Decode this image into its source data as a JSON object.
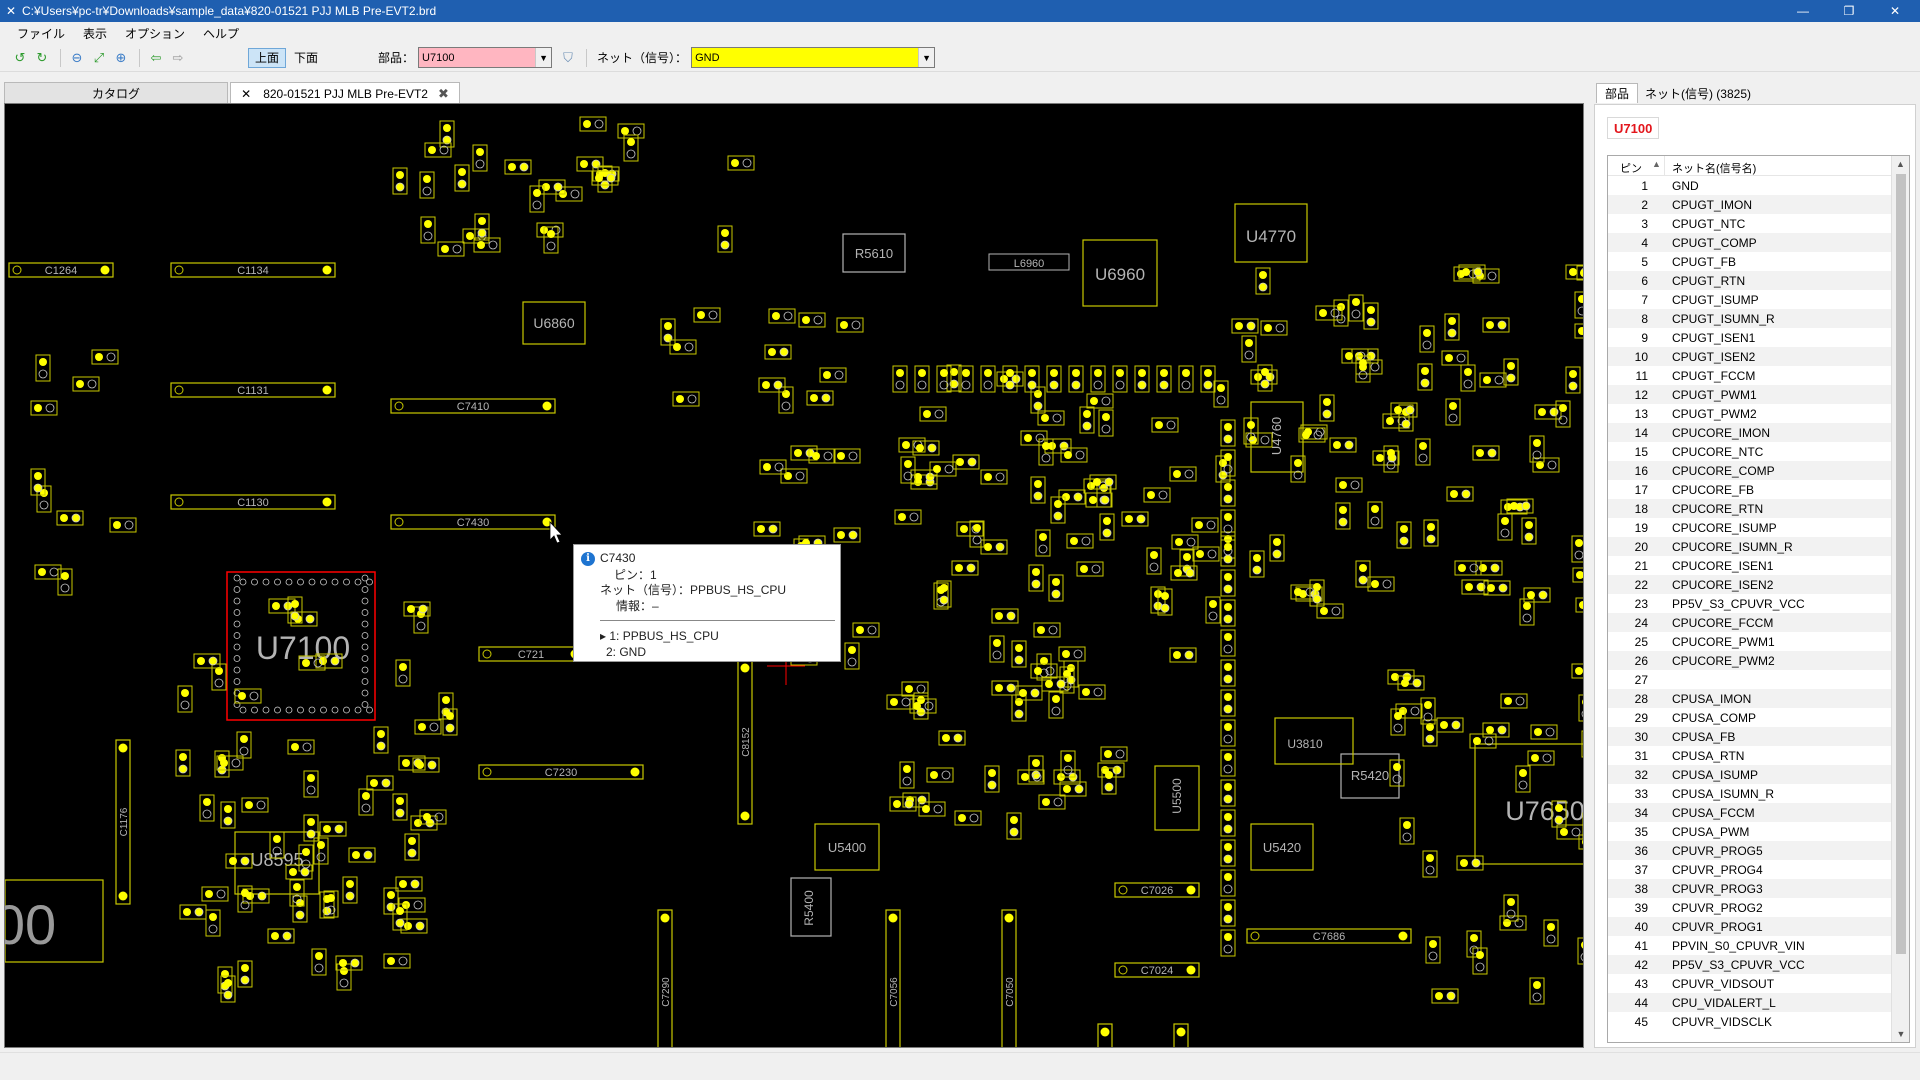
{
  "window": {
    "title": "C:¥Users¥pc-tr¥Downloads¥sample_data¥820-01521 PJJ MLB Pre-EVT2.brd",
    "controls": [
      "—",
      "❐",
      "✕"
    ]
  },
  "menu": [
    "ファイル",
    "表示",
    "オプション",
    "ヘルプ"
  ],
  "toolbar": {
    "top_label": "上面",
    "bottom_label": "下面",
    "part_label": "部品：",
    "part_value": "U7100",
    "net_label": "ネット（信号）：",
    "net_value": "GND",
    "part_color": "#ffb6c1",
    "net_color": "#ffff00"
  },
  "tabs": {
    "catalog": "カタログ",
    "board": "820-01521 PJJ MLB Pre-EVT2"
  },
  "board": {
    "component_labels": {
      "u7100": "U7100",
      "u7650": "U7650",
      "u8595": "U8595",
      "r5610": "R5610",
      "r5420": "R5420",
      "u4770": "U4770",
      "c1264": "C1264",
      "c1134": "C1134",
      "c1131": "C1131",
      "c1130": "C1130",
      "c7410": "C7410",
      "c7430": "C7430",
      "c7230": "C7230",
      "c7026": "C7026",
      "c7024": "C7024",
      "c7686": "C7686",
      "c7685": "C7685",
      "l6960": "L6960",
      "u6860": "U6860",
      "u5400": "U5400",
      "u5420": "U5420",
      "u5500": "U5500",
      "u3810": "U3810",
      "r5400": "R5400",
      "c7290": "C7290",
      "c7056": "C7056",
      "c7050": "C7050",
      "c7025": "C7025",
      "c7027": "C7027",
      "c1176": "C1176",
      "c8152": "C8152",
      "u6960": "U6960",
      "u4760": "U4760",
      "c721": "C721",
      "big_00": "00"
    }
  },
  "tooltip": {
    "title": "C7430",
    "pin": "ピン：1",
    "net": "ネット（信号）：PPBUS_HS_CPU",
    "info": "情報：–",
    "pin1": "▸ 1: PPBUS_HS_CPU",
    "pin2": "2: GND"
  },
  "right_panel": {
    "tab_parts": "部品",
    "tab_nets": "ネット(信号) (3825)",
    "part": "U7100",
    "col_pin": "ピン",
    "col_net": "ネット名(信号名)",
    "pins": [
      {
        "pin": "1",
        "net": "GND"
      },
      {
        "pin": "2",
        "net": "CPUGT_IMON"
      },
      {
        "pin": "3",
        "net": "CPUGT_NTC"
      },
      {
        "pin": "4",
        "net": "CPUGT_COMP"
      },
      {
        "pin": "5",
        "net": "CPUGT_FB"
      },
      {
        "pin": "6",
        "net": "CPUGT_RTN"
      },
      {
        "pin": "7",
        "net": "CPUGT_ISUMP"
      },
      {
        "pin": "8",
        "net": "CPUGT_ISUMN_R"
      },
      {
        "pin": "9",
        "net": "CPUGT_ISEN1"
      },
      {
        "pin": "10",
        "net": "CPUGT_ISEN2"
      },
      {
        "pin": "11",
        "net": "CPUGT_FCCM"
      },
      {
        "pin": "12",
        "net": "CPUGT_PWM1"
      },
      {
        "pin": "13",
        "net": "CPUGT_PWM2"
      },
      {
        "pin": "14",
        "net": "CPUCORE_IMON"
      },
      {
        "pin": "15",
        "net": "CPUCORE_NTC"
      },
      {
        "pin": "16",
        "net": "CPUCORE_COMP"
      },
      {
        "pin": "17",
        "net": "CPUCORE_FB"
      },
      {
        "pin": "18",
        "net": "CPUCORE_RTN"
      },
      {
        "pin": "19",
        "net": "CPUCORE_ISUMP"
      },
      {
        "pin": "20",
        "net": "CPUCORE_ISUMN_R"
      },
      {
        "pin": "21",
        "net": "CPUCORE_ISEN1"
      },
      {
        "pin": "22",
        "net": "CPUCORE_ISEN2"
      },
      {
        "pin": "23",
        "net": "PP5V_S3_CPUVR_VCC"
      },
      {
        "pin": "24",
        "net": "CPUCORE_FCCM"
      },
      {
        "pin": "25",
        "net": "CPUCORE_PWM1"
      },
      {
        "pin": "26",
        "net": "CPUCORE_PWM2"
      },
      {
        "pin": "27",
        "net": ""
      },
      {
        "pin": "28",
        "net": "CPUSA_IMON"
      },
      {
        "pin": "29",
        "net": "CPUSA_COMP"
      },
      {
        "pin": "30",
        "net": "CPUSA_FB"
      },
      {
        "pin": "31",
        "net": "CPUSA_RTN"
      },
      {
        "pin": "32",
        "net": "CPUSA_ISUMP"
      },
      {
        "pin": "33",
        "net": "CPUSA_ISUMN_R"
      },
      {
        "pin": "34",
        "net": "CPUSA_FCCM"
      },
      {
        "pin": "35",
        "net": "CPUSA_PWM"
      },
      {
        "pin": "36",
        "net": "CPUVR_PROG5"
      },
      {
        "pin": "37",
        "net": "CPUVR_PROG4"
      },
      {
        "pin": "38",
        "net": "CPUVR_PROG3"
      },
      {
        "pin": "39",
        "net": "CPUVR_PROG2"
      },
      {
        "pin": "40",
        "net": "CPUVR_PROG1"
      },
      {
        "pin": "41",
        "net": "PPVIN_S0_CPUVR_VIN"
      },
      {
        "pin": "42",
        "net": "PP5V_S3_CPUVR_VCC"
      },
      {
        "pin": "43",
        "net": "CPUVR_VIDSOUT"
      },
      {
        "pin": "44",
        "net": "CPU_VIDALERT_L"
      },
      {
        "pin": "45",
        "net": "CPUVR_VIDSCLK"
      }
    ]
  },
  "colors": {
    "outline": "#c8c800",
    "pad": "#ffff00",
    "silk_label": "#b4b4b4",
    "highlight": "#ff0000",
    "trace": "#00a000",
    "title_bar": "#1f5fb0"
  }
}
